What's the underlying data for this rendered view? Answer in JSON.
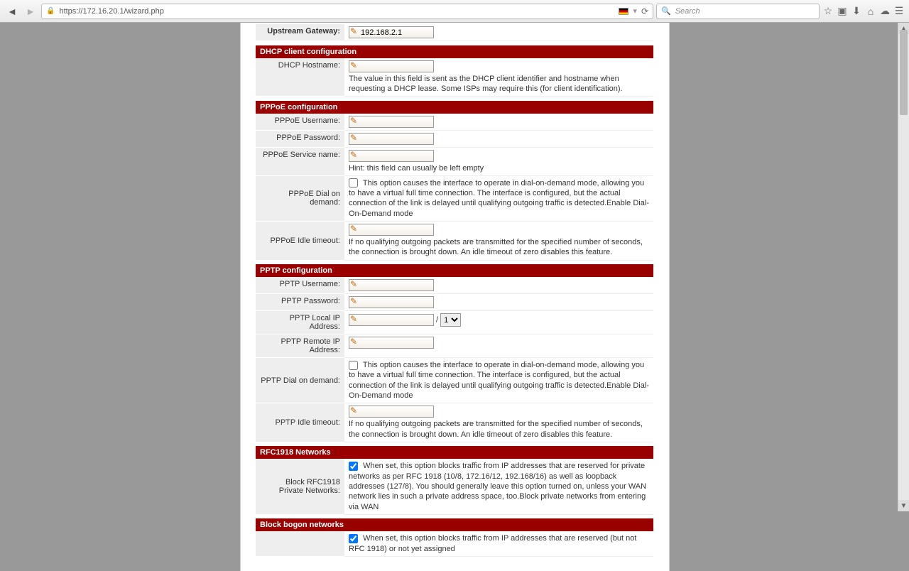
{
  "browser": {
    "url": "https://172.16.20.1/wizard.php",
    "search_placeholder": "Search"
  },
  "upstream": {
    "label": "Upstream Gateway:",
    "value": "192.168.2.1"
  },
  "dhcp": {
    "header": "DHCP client configuration",
    "hostname_label": "DHCP Hostname:",
    "hostname_value": "",
    "hostname_hint": "The value in this field is sent as the DHCP client identifier and hostname when requesting a DHCP lease. Some ISPs may require this (for client identification)."
  },
  "pppoe": {
    "header": "PPPoE configuration",
    "username_label": "PPPoE Username:",
    "username_value": "",
    "password_label": "PPPoE Password:",
    "password_value": "",
    "service_label": "PPPoE Service name:",
    "service_value": "",
    "service_hint": "Hint: this field can usually be left empty",
    "dod_label": "PPPoE Dial on demand:",
    "dod_hint": "This option causes the interface to operate in dial-on-demand mode, allowing you to have a virtual full time connection. The interface is configured, but the actual connection of the link is delayed until qualifying outgoing traffic is detected.Enable Dial-On-Demand mode",
    "idle_label": "PPPoE Idle timeout:",
    "idle_value": "",
    "idle_hint": "If no qualifying outgoing packets are transmitted for the specified number of seconds, the connection is brought down. An idle timeout of zero disables this feature."
  },
  "pptp": {
    "header": "PPTP configuration",
    "username_label": "PPTP Username:",
    "username_value": "",
    "password_label": "PPTP Password:",
    "password_value": "",
    "localip_label": "PPTP Local IP Address:",
    "localip_value": "",
    "localip_mask_sel": "1",
    "remoteip_label": "PPTP Remote IP Address:",
    "remoteip_value": "",
    "dod_label": "PPTP Dial on demand:",
    "dod_hint": "This option causes the interface to operate in dial-on-demand mode, allowing you to have a virtual full time connection. The interface is configured, but the actual connection of the link is delayed until qualifying outgoing traffic is detected.Enable Dial-On-Demand mode",
    "idle_label": "PPTP Idle timeout:",
    "idle_value": "",
    "idle_hint": "If no qualifying outgoing packets are transmitted for the specified number of seconds, the connection is brought down. An idle timeout of zero disables this feature."
  },
  "rfc1918": {
    "header": "RFC1918 Networks",
    "block_label": "Block RFC1918 Private Networks:",
    "block_hint": "When set, this option blocks traffic from IP addresses that are reserved for private networks as per RFC 1918 (10/8, 172.16/12, 192.168/16) as well as loopback addresses (127/8). You should generally leave this option turned on, unless your WAN network lies in such a private address space, too.Block private networks from entering via WAN"
  },
  "bogon": {
    "header": "Block bogon networks",
    "block_hint": "When set, this option blocks traffic from IP addresses that are reserved (but not RFC 1918) or not yet assigned"
  }
}
